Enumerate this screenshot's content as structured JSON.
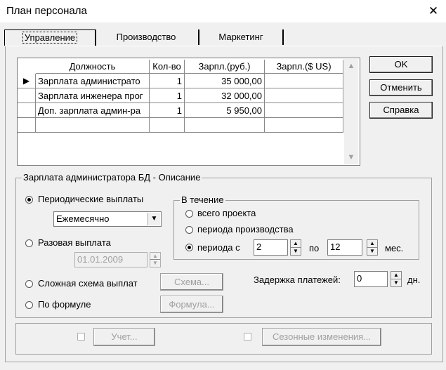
{
  "window": {
    "title": "План персонала",
    "close_glyph": "✕"
  },
  "tabs": [
    {
      "label": "Управление"
    },
    {
      "label": "Производство"
    },
    {
      "label": "Маркетинг"
    }
  ],
  "grid": {
    "columns": [
      "Должность",
      "Кол-во",
      "Зарпл.(руб.)",
      "Зарпл.($ US)"
    ],
    "rows": [
      {
        "name": "Зарплата администрато",
        "qty": "1",
        "rub": "35 000,00",
        "usd": ""
      },
      {
        "name": "Зарплата инженера прог",
        "qty": "1",
        "rub": "32 000,00",
        "usd": ""
      },
      {
        "name": "Доп. зарплата админ-ра",
        "qty": "1",
        "rub": "5 950,00",
        "usd": ""
      }
    ]
  },
  "buttons": {
    "ok": "OK",
    "cancel": "Отменить",
    "help": "Справка"
  },
  "description": {
    "legend": "Зарплата администратора БД - Описание",
    "periodic_label": "Периодические выплаты",
    "periodic_value": "Ежемесячно",
    "one_time_label": "Разовая выплата",
    "one_time_date": "01.01.2009",
    "complex_label": "Сложная схема выплат",
    "scheme_button": "Схема...",
    "formula_label": "По формуле",
    "formula_button": "Формула...",
    "during": {
      "legend": "В течение",
      "whole_project": "всего проекта",
      "production_period": "периода производства",
      "period_from": "периода с",
      "from_value": "2",
      "to_label": "по",
      "to_value": "12",
      "unit": "мес."
    },
    "delay_label": "Задержка платежей:",
    "delay_value": "0",
    "delay_unit": "дн."
  },
  "bottom": {
    "account_button": "Учет...",
    "seasonal_button": "Сезонные изменения..."
  }
}
